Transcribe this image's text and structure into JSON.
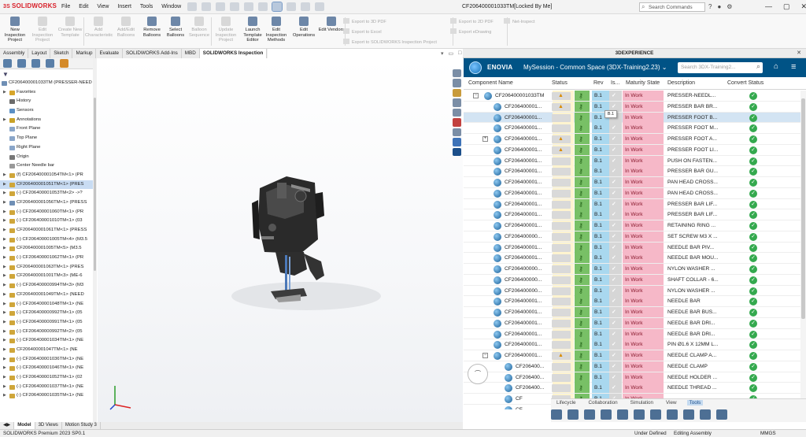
{
  "app": {
    "logo": "SOLIDWORKS",
    "menu": [
      "File",
      "Edit",
      "View",
      "Insert",
      "Tools",
      "Window"
    ],
    "document_title": "CF206400001033TM[Locked By Me]",
    "search_placeholder": "Search Commands",
    "window_buttons": [
      "—",
      "▢",
      "✕"
    ]
  },
  "ribbon": {
    "buttons": [
      {
        "label": "New Inspection Project",
        "enabled": true
      },
      {
        "label": "Edit Inspection Project",
        "enabled": false
      },
      {
        "label": "Create New Template",
        "enabled": false
      },
      {
        "label": "Add Characteristic",
        "enabled": false
      },
      {
        "label": "Add/Edit Balloons",
        "enabled": false
      },
      {
        "label": "Remove Balloons",
        "enabled": true
      },
      {
        "label": "Select Balloons",
        "enabled": true
      },
      {
        "label": "Balloon Sequence",
        "enabled": false
      },
      {
        "label": "Update Inspection Project",
        "enabled": false
      },
      {
        "label": "Launch Template Editor",
        "enabled": true
      },
      {
        "label": "Edit Inspection Methods",
        "enabled": true
      },
      {
        "label": "Edit Operations",
        "enabled": true
      },
      {
        "label": "Edit Vendors",
        "enabled": true
      }
    ],
    "exports": [
      "Export to 3D PDF",
      "Export to Excel",
      "Export to SOLIDWORKS Inspection Project"
    ],
    "exports2": [
      "Export to 2D PDF",
      "Export eDrawing"
    ],
    "net_inspect": "Net-Inspect"
  },
  "tabs": [
    "Assembly",
    "Layout",
    "Sketch",
    "Markup",
    "Evaluate",
    "SOLIDWORKS Add-Ins",
    "MBD",
    "SOLIDWORKS Inspection"
  ],
  "active_tab": "SOLIDWORKS Inspection",
  "tree": [
    {
      "label": "CF206400001033TM (PRESSER-NEED",
      "level": 0,
      "icon": "assembly",
      "arrow": false
    },
    {
      "label": "Favorites",
      "level": 1,
      "icon": "folder",
      "arrow": true
    },
    {
      "label": "History",
      "level": 1,
      "icon": "history",
      "arrow": false
    },
    {
      "label": "Sensors",
      "level": 1,
      "icon": "sensor",
      "arrow": false
    },
    {
      "label": "Annotations",
      "level": 1,
      "icon": "annotation",
      "arrow": true
    },
    {
      "label": "Front Plane",
      "level": 1,
      "icon": "plane",
      "arrow": false
    },
    {
      "label": "Top Plane",
      "level": 1,
      "icon": "plane",
      "arrow": false
    },
    {
      "label": "Right Plane",
      "level": 1,
      "icon": "plane",
      "arrow": false
    },
    {
      "label": "Origin",
      "level": 1,
      "icon": "origin",
      "arrow": false
    },
    {
      "label": "Center Needle bar",
      "level": 1,
      "icon": "axis",
      "arrow": false
    },
    {
      "label": "(f) CF206400001054TM<1> (PR",
      "level": 1,
      "icon": "part",
      "arrow": true
    },
    {
      "label": "CF206400001051TM<1> (PRES",
      "level": 1,
      "icon": "part",
      "arrow": true,
      "selected": true
    },
    {
      "label": "(-) CF206400001053TM<2> ->?",
      "level": 1,
      "icon": "part",
      "arrow": true
    },
    {
      "label": "CF206400001056TM<1> (PRESS",
      "level": 1,
      "icon": "assembly",
      "arrow": true
    },
    {
      "label": "(-) CF206400001060TM<1> (PR",
      "level": 1,
      "icon": "part",
      "arrow": true
    },
    {
      "label": "(-) CF206400001010TM<1> (03",
      "level": 1,
      "icon": "part",
      "arrow": true
    },
    {
      "label": "CF206400001061TM<1> (PRESS",
      "level": 1,
      "icon": "part",
      "arrow": true
    },
    {
      "label": "(-) CF206400001005TM<4> (M3.5",
      "level": 1,
      "icon": "part",
      "arrow": true
    },
    {
      "label": "CF206400001005TM<5> (M3.5",
      "level": 1,
      "icon": "part",
      "arrow": true
    },
    {
      "label": "(-) CF206400001062TM<1> (PR",
      "level": 1,
      "icon": "part",
      "arrow": true
    },
    {
      "label": "CF206400001063TM<1> (PRES",
      "level": 1,
      "icon": "part",
      "arrow": true
    },
    {
      "label": "CF206400001001TM<3> (ME-6",
      "level": 1,
      "icon": "part",
      "arrow": true
    },
    {
      "label": "(-) CF206400000994TM<3> (M3",
      "level": 1,
      "icon": "part",
      "arrow": true
    },
    {
      "label": "CF206400001049TM<1> (NEED",
      "level": 1,
      "icon": "part",
      "arrow": true
    },
    {
      "label": "(-) CF206400001048TM<1> (NE",
      "level": 1,
      "icon": "part",
      "arrow": true
    },
    {
      "label": "(-) CF206400000992TM<1> (05",
      "level": 1,
      "icon": "part",
      "arrow": true
    },
    {
      "label": "(-) CF206400000991TM<1> (05",
      "level": 1,
      "icon": "part",
      "arrow": true
    },
    {
      "label": "(-) CF206400000992TM<2> (05",
      "level": 1,
      "icon": "part",
      "arrow": true
    },
    {
      "label": "(-) CF206400001034TM<1> (NE",
      "level": 1,
      "icon": "part",
      "arrow": true
    },
    {
      "label": "CF206400001047TM<1> (NE",
      "level": 1,
      "icon": "part",
      "arrow": true
    },
    {
      "label": "(-) CF206400001036TM<1> (NE",
      "level": 1,
      "icon": "part",
      "arrow": true
    },
    {
      "label": "(-) CF206400001046TM<1> (NE",
      "level": 1,
      "icon": "part",
      "arrow": true
    },
    {
      "label": "(-) CF206400001052TM<1> (02",
      "level": 1,
      "icon": "part",
      "arrow": true
    },
    {
      "label": "(-) CF206400001037TM<1> (NE",
      "level": 1,
      "icon": "part",
      "arrow": true
    },
    {
      "label": "(-) CF206400001035TM<1> (NE",
      "level": 1,
      "icon": "part",
      "arrow": true
    }
  ],
  "xp": {
    "strip_title": "3DEXPERIENCE",
    "brand": "ENOVIA",
    "session": "MySession - Common Space (3DX-Training2.23)",
    "search_placeholder": "Search 3DX-Training2...",
    "columns": [
      "Component Name",
      "Status",
      "Rev",
      "Is...",
      "Maturity State",
      "Description",
      "Convert Status"
    ],
    "rows": [
      {
        "name": "CF206400001033TM",
        "level": 0,
        "expand": "−",
        "warn": true,
        "rev": "B.1",
        "state": "In Work",
        "desc": "PRESSER-NEEDL..."
      },
      {
        "name": "CF206400001...",
        "level": 1,
        "expand": "",
        "warn": true,
        "rev": "B.1",
        "state": "In Work",
        "desc": "PRESSER BAR BR..."
      },
      {
        "name": "CF206400001...",
        "level": 1,
        "expand": "",
        "warn": false,
        "rev": "B.1",
        "state": "In Work",
        "desc": "PRESSER FOOT B...",
        "highlight": true
      },
      {
        "name": "CF206400001...",
        "level": 1,
        "expand": "",
        "warn": false,
        "rev": "B.1",
        "state": "In Work",
        "desc": "PRESSER FOOT M..."
      },
      {
        "name": "CF206400001...",
        "level": 1,
        "expand": "+",
        "warn": true,
        "rev": "B.1",
        "state": "In Work",
        "desc": "PRESSER FOOT A..."
      },
      {
        "name": "CF206400001...",
        "level": 1,
        "expand": "",
        "warn": true,
        "rev": "B.1",
        "state": "In Work",
        "desc": "PRESSER FOOT LI..."
      },
      {
        "name": "CF206400001...",
        "level": 1,
        "expand": "",
        "warn": false,
        "rev": "B.1",
        "state": "In Work",
        "desc": "PUSH ON FASTEN..."
      },
      {
        "name": "CF206400001...",
        "level": 1,
        "expand": "",
        "warn": false,
        "rev": "B.1",
        "state": "In Work",
        "desc": "PRESSER BAR GU..."
      },
      {
        "name": "CF206400001...",
        "level": 1,
        "expand": "",
        "warn": false,
        "rev": "B.1",
        "state": "In Work",
        "desc": "PAN HEAD CROSS..."
      },
      {
        "name": "CF206400001...",
        "level": 1,
        "expand": "",
        "warn": false,
        "rev": "B.1",
        "state": "In Work",
        "desc": "PAN HEAD CROSS..."
      },
      {
        "name": "CF206400001...",
        "level": 1,
        "expand": "",
        "warn": false,
        "rev": "B.1",
        "state": "In Work",
        "desc": "PRESSER BAR LIF..."
      },
      {
        "name": "CF206400001...",
        "level": 1,
        "expand": "",
        "warn": false,
        "rev": "B.1",
        "state": "In Work",
        "desc": "PRESSER BAR LIF..."
      },
      {
        "name": "CF206400001...",
        "level": 1,
        "expand": "",
        "warn": false,
        "rev": "B.1",
        "state": "In Work",
        "desc": "RETAINING RING ..."
      },
      {
        "name": "CF206400000...",
        "level": 1,
        "expand": "",
        "warn": false,
        "rev": "B.1",
        "state": "In Work",
        "desc": "SET SCREW M3 X ..."
      },
      {
        "name": "CF206400001...",
        "level": 1,
        "expand": "",
        "warn": false,
        "rev": "B.1",
        "state": "In Work",
        "desc": "NEEDLE BAR PIV..."
      },
      {
        "name": "CF206400001...",
        "level": 1,
        "expand": "",
        "warn": false,
        "rev": "B.1",
        "state": "In Work",
        "desc": "NEEDLE BAR MOU..."
      },
      {
        "name": "CF206400000...",
        "level": 1,
        "expand": "",
        "warn": false,
        "rev": "B.1",
        "state": "In Work",
        "desc": "NYLON WASHER ..."
      },
      {
        "name": "CF206400000...",
        "level": 1,
        "expand": "",
        "warn": false,
        "rev": "B.1",
        "state": "In Work",
        "desc": "SHAFT COLLAR - 6..."
      },
      {
        "name": "CF206400000...",
        "level": 1,
        "expand": "",
        "warn": false,
        "rev": "B.1",
        "state": "In Work",
        "desc": "NYLON WASHER ..."
      },
      {
        "name": "CF206400001...",
        "level": 1,
        "expand": "",
        "warn": false,
        "rev": "B.1",
        "state": "In Work",
        "desc": "NEEDLE BAR"
      },
      {
        "name": "CF206400001...",
        "level": 1,
        "expand": "",
        "warn": false,
        "rev": "B.1",
        "state": "In Work",
        "desc": "NEEDLE BAR BUS..."
      },
      {
        "name": "CF206400001...",
        "level": 1,
        "expand": "",
        "warn": false,
        "rev": "B.1",
        "state": "In Work",
        "desc": "NEEDLE BAR DRI..."
      },
      {
        "name": "CF206400001...",
        "level": 1,
        "expand": "",
        "warn": false,
        "rev": "B.1",
        "state": "In Work",
        "desc": "NEEDLE BAR DRI..."
      },
      {
        "name": "CF206400001...",
        "level": 1,
        "expand": "",
        "warn": false,
        "rev": "B.1",
        "state": "In Work",
        "desc": "PIN Ø1.6 X 12MM L..."
      },
      {
        "name": "CF206400001...",
        "level": 1,
        "expand": "−",
        "warn": true,
        "rev": "B.1",
        "state": "In Work",
        "desc": "NEEDLE CLAMP A..."
      },
      {
        "name": "CF206400...",
        "level": 2,
        "expand": "",
        "warn": false,
        "rev": "B.1",
        "state": "In Work",
        "desc": "NEEDLE CLAMP"
      },
      {
        "name": "CF206400...",
        "level": 2,
        "expand": "",
        "warn": false,
        "rev": "B.1",
        "state": "In Work",
        "desc": "NEEDLE HOLDER ..."
      },
      {
        "name": "CF206400...",
        "level": 2,
        "expand": "",
        "warn": false,
        "rev": "B.1",
        "state": "In Work",
        "desc": "NEEDLE THREAD ..."
      },
      {
        "name": "CF",
        "level": 2,
        "expand": "",
        "warn": false,
        "rev": "B.1",
        "state": "In Work",
        "desc": ""
      },
      {
        "name": "CF",
        "level": 2,
        "expand": "",
        "warn": false,
        "rev": "B.1",
        "state": "In Work",
        "desc": ""
      }
    ],
    "tooltip": "B.1",
    "bottom_tabs": [
      "Lifecycle",
      "Collaboration",
      "Simulation",
      "View",
      "Tools"
    ],
    "active_bottom_tab": "Tools"
  },
  "bottom_tabs": [
    "Model",
    "3D Views",
    "Motion Study 3"
  ],
  "active_bottom_tab": "Model",
  "status": {
    "version": "SOLIDWORKS Premium 2023 SP0.1",
    "defined": "Under Defined",
    "editing": "Editing Assembly",
    "units": "MMGS"
  },
  "colors": {
    "enovia_bar": "#005386",
    "maturity_in_work": "#f6b8c8",
    "convert_ok": "#34a94e",
    "selected_tree_row": "#c9dcf3"
  }
}
